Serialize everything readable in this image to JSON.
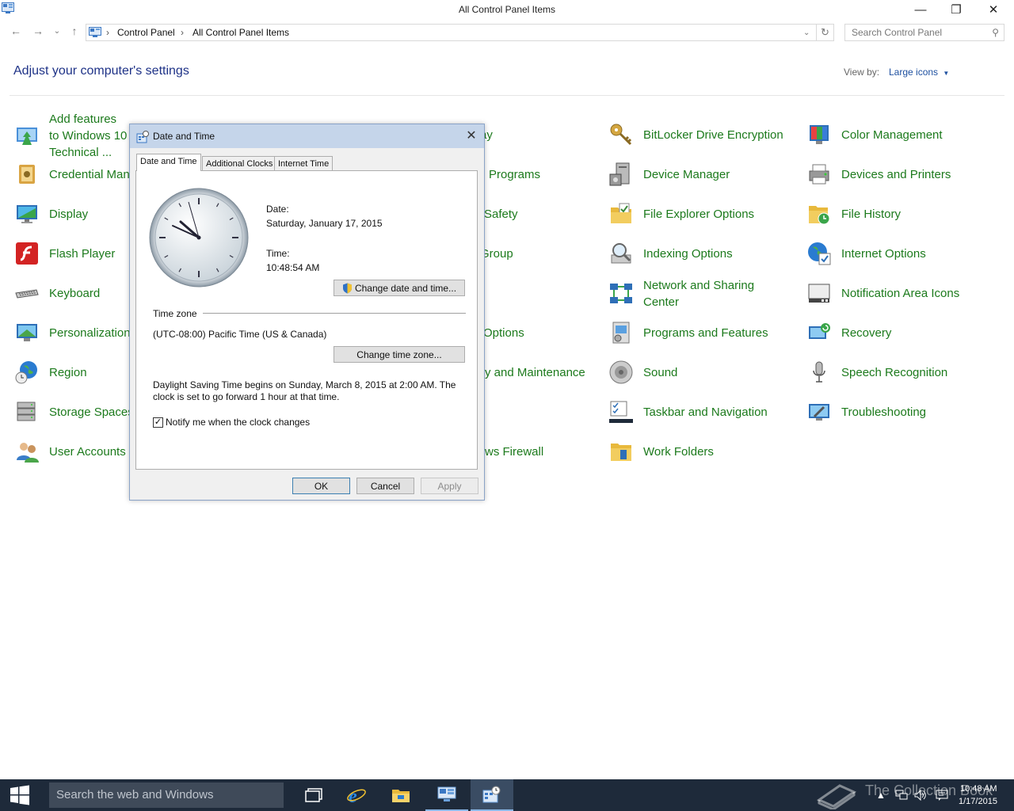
{
  "window": {
    "title": "All Control Panel Items"
  },
  "address_bar": {
    "crumbs": [
      "Control Panel",
      "All Control Panel Items"
    ]
  },
  "search": {
    "placeholder": "Search Control Panel"
  },
  "content": {
    "heading": "Adjust your computer's settings",
    "view_by_label": "View by:",
    "view_by_value": "Large icons"
  },
  "items": {
    "add_features": "Add features to Windows 10 Technical ...",
    "credential_manager": "Credential Manager",
    "display": "Display",
    "flash_player": "Flash Player",
    "keyboard": "Keyboard",
    "personalization": "Personalization",
    "region": "Region",
    "storage_spaces": "Storage Spaces",
    "user_accounts": "User Accounts",
    "col2_autoplay": "ay",
    "col2_default_programs": "Programs",
    "col2_family_safety": "Safety",
    "col2_homegroup": "Group",
    "col2_power_options": "Options",
    "col2_security_maintenance": "y and Maintenance",
    "col2_windows_firewall": "ws Firewall",
    "bitlocker": "BitLocker Drive Encryption",
    "device_manager": "Device Manager",
    "file_explorer_options": "File Explorer Options",
    "indexing_options": "Indexing Options",
    "network_sharing": "Network and Sharing Center",
    "programs_features": "Programs and Features",
    "sound": "Sound",
    "taskbar_navigation": "Taskbar and Navigation",
    "work_folders": "Work Folders",
    "color_management": "Color Management",
    "devices_printers": "Devices and Printers",
    "file_history": "File History",
    "internet_options": "Internet Options",
    "notification_area_icons": "Notification Area Icons",
    "recovery": "Recovery",
    "speech_recognition": "Speech Recognition",
    "troubleshooting": "Troubleshooting"
  },
  "dialog": {
    "title": "Date and Time",
    "tabs": [
      "Date and Time",
      "Additional Clocks",
      "Internet Time"
    ],
    "date_label": "Date:",
    "date_value": "Saturday, January 17, 2015",
    "time_label": "Time:",
    "time_value": "10:48:54 AM",
    "change_datetime_button": "Change date and time...",
    "timezone_label": "Time zone",
    "timezone_value": "(UTC-08:00) Pacific Time (US & Canada)",
    "change_timezone_button": "Change time zone...",
    "dst_line1": "Daylight Saving Time begins on Sunday, March 8, 2015 at 2:00 AM. The",
    "dst_line2": "clock is set to go forward 1 hour at that time.",
    "notify_label": "Notify me when the clock changes",
    "notify_checked": true,
    "ok_button": "OK",
    "cancel_button": "Cancel",
    "apply_button": "Apply"
  },
  "taskbar": {
    "search_placeholder": "Search the web and Windows",
    "clock_time": "10:48 AM",
    "clock_date": "1/17/2015",
    "watermark": "The Collection Book"
  }
}
